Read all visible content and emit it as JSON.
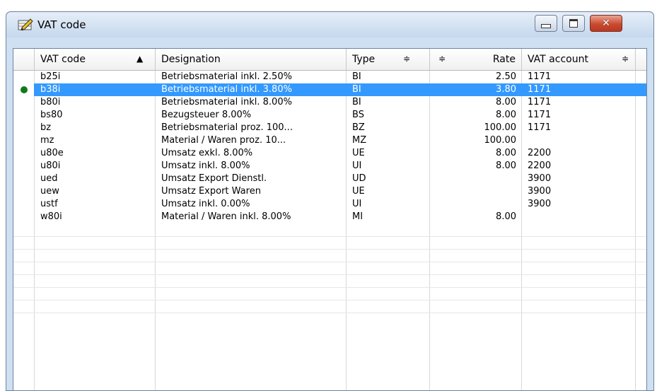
{
  "window": {
    "title": "VAT code",
    "controls": {
      "minimize": "minimize",
      "maximize": "maximize",
      "close": "close"
    }
  },
  "table": {
    "columns": [
      {
        "label": "VAT code",
        "sort": "ascending"
      },
      {
        "label": "Designation"
      },
      {
        "label": "Type",
        "sort": "sortable"
      },
      {
        "label": "Rate",
        "sort": "sortable"
      },
      {
        "label": "VAT account",
        "sort": "sortable"
      }
    ],
    "sort_ascending_glyph": "▲",
    "sortable_glyph": "≑",
    "selected_row": 1,
    "rows": [
      {
        "code": "b25i",
        "designation": "Betriebsmaterial inkl. 2.50%",
        "type": "BI",
        "rate": "2.50",
        "account": "1171"
      },
      {
        "code": "b38i",
        "designation": "Betriebsmaterial inkl. 3.80%",
        "type": "BI",
        "rate": "3.80",
        "account": "1171"
      },
      {
        "code": "b80i",
        "designation": "Betriebsmaterial inkl. 8.00%",
        "type": "BI",
        "rate": "8.00",
        "account": "1171"
      },
      {
        "code": "bs80",
        "designation": "Bezugsteuer 8.00%",
        "type": "BS",
        "rate": "8.00",
        "account": "1171"
      },
      {
        "code": "bz",
        "designation": "Betriebsmaterial proz. 100...",
        "type": "BZ",
        "rate": "100.00",
        "account": "1171"
      },
      {
        "code": "mz",
        "designation": "Material / Waren proz. 10...",
        "type": "MZ",
        "rate": "100.00",
        "account": ""
      },
      {
        "code": "u80e",
        "designation": "Umsatz exkl. 8.00%",
        "type": "UE",
        "rate": "8.00",
        "account": "2200"
      },
      {
        "code": "u80i",
        "designation": "Umsatz inkl. 8.00%",
        "type": "UI",
        "rate": "8.00",
        "account": "2200"
      },
      {
        "code": "ued",
        "designation": "Umsatz Export Dienstl.",
        "type": "UD",
        "rate": "",
        "account": "3900"
      },
      {
        "code": "uew",
        "designation": "Umsatz Export Waren",
        "type": "UE",
        "rate": "",
        "account": "3900"
      },
      {
        "code": "ustf",
        "designation": "Umsatz inkl. 0.00%",
        "type": "UI",
        "rate": "",
        "account": "3900"
      },
      {
        "code": "w80i",
        "designation": "Material / Waren inkl. 8.00%",
        "type": "MI",
        "rate": "8.00",
        "account": ""
      }
    ],
    "empty_rows": 7
  },
  "colors": {
    "selection": "#3399ff",
    "row_marker": "#0f7a1a",
    "close_button": "#c94a30"
  }
}
